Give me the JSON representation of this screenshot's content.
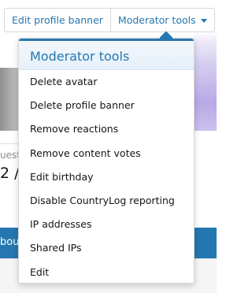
{
  "toolbar": {
    "edit_banner_label": "Edit profile banner",
    "moderator_tools_label": "Moderator tools"
  },
  "background": {
    "left_text": "uest",
    "left_number": "2 /",
    "tab_label": "bou"
  },
  "menu": {
    "title": "Moderator tools",
    "items": [
      "Delete avatar",
      "Delete profile banner",
      "Remove reactions",
      "Remove content votes",
      "Edit birthday",
      "Disable CountryLog reporting",
      "IP addresses",
      "Shared IPs",
      "Edit"
    ]
  },
  "colors": {
    "accent": "#2577b1",
    "header_bg": "#e6f0f9"
  }
}
